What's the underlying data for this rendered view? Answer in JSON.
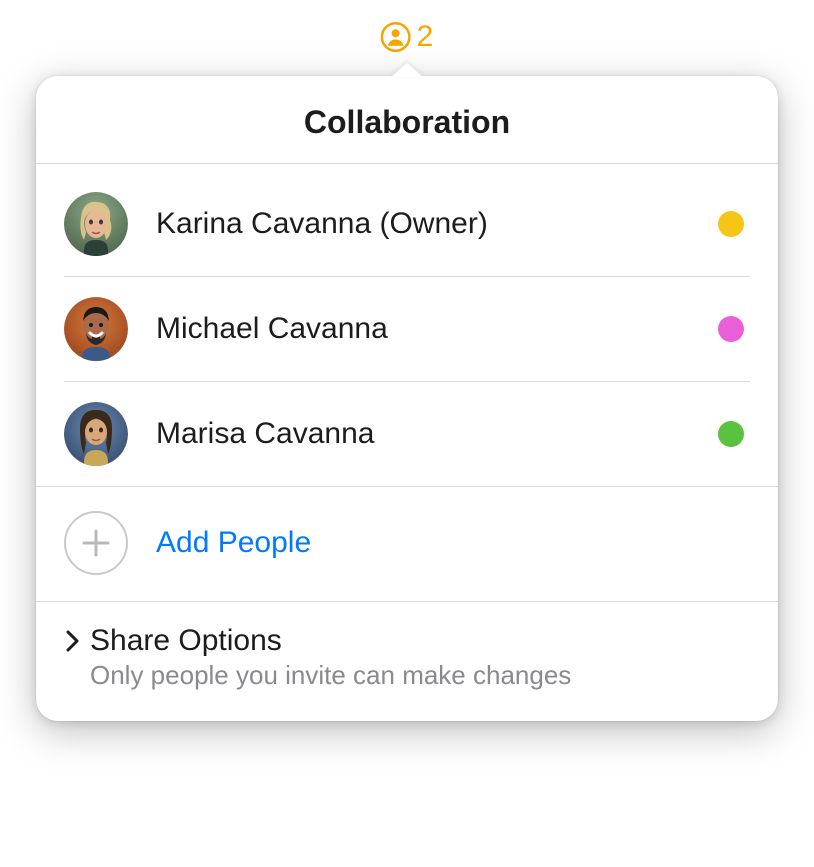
{
  "indicator": {
    "count": "2"
  },
  "popover": {
    "title": "Collaboration",
    "people": [
      {
        "name": "Karina Cavanna (Owner)",
        "statusColor": "#f5c518"
      },
      {
        "name": "Michael Cavanna",
        "statusColor": "#e85fd8"
      },
      {
        "name": "Marisa Cavanna",
        "statusColor": "#5ac23e"
      }
    ],
    "addPeople": {
      "label": "Add People"
    },
    "shareOptions": {
      "title": "Share Options",
      "subtitle": "Only people you invite can make changes"
    }
  },
  "colors": {
    "accentOrange": "#f7a400",
    "link": "#007aff"
  }
}
